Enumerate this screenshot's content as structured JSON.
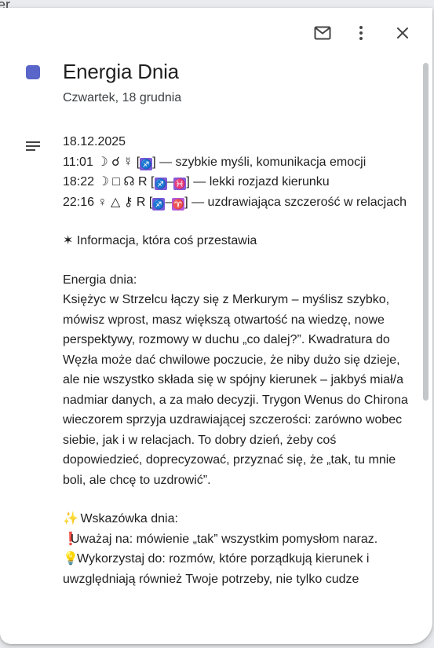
{
  "peek_text": "er",
  "toolbar": {
    "icons": [
      "mail-icon",
      "more-vertical-icon",
      "close-icon"
    ]
  },
  "event": {
    "color": "#5965c8",
    "title": "Energia Dnia",
    "date": "Czwartek, 18 grudnia"
  },
  "description": {
    "date_line": "18.12.2025",
    "line1_time": "11:01",
    "line1_symbols": "☽ ☌ ☿ [",
    "line1_sign": "♐",
    "line1_text": "] — szybkie myśli, komunikacja emocji",
    "line2_time": "18:22",
    "line2_symbols": "☽ □ ☊ R [",
    "line2_sign_a": "♐",
    "line2_sep": "–",
    "line2_sign_b": "♓",
    "line2_text": "] — lekki rozjazd kierunku",
    "line3_time": "22:16",
    "line3_symbols": "♀ △ ⚷ R [",
    "line3_sign_a": "♐",
    "line3_sep": "–",
    "line3_sign_b": "♈",
    "line3_text": "] — uzdrawiająca szczerość w relacjach",
    "info": "✶ Informacja, która coś przestawia",
    "energy_heading": "Energia dnia:",
    "energy_body": "Księżyc w Strzelcu łączy się z Merkurym – myślisz szybko, mówisz wprost, masz większą otwartość na wiedzę, nowe perspektywy, rozmowy w duchu „co dalej?”. Kwadratura do Węzła może dać chwilowe poczucie, że niby dużo się dzieje, ale nie wszystko składa się w spójny kierunek – jakbyś miał/a nadmiar danych, a za mało decyzji. Trygon Wenus do Chirona wieczorem sprzyja uzdrawiającej szczerości: zarówno wobec siebie, jak i w relacjach. To dobry dzień, żeby coś dopowiedzieć, doprecyzować, przyznać się, że „tak, tu mnie boli, ale chcę to uzdrowić”.",
    "tip_emoji": "✨",
    "tip_heading": "Wskazówka dnia:",
    "warn_emoji": "❗",
    "warn_text": "Uważaj na: mówienie „tak” wszystkim pomysłom naraz.",
    "use_emoji": "💡",
    "use_text": "Wykorzystaj do: rozmów, które porządkują kierunek i uwzględniają również Twoje potrzeby, nie tylko cudze"
  }
}
